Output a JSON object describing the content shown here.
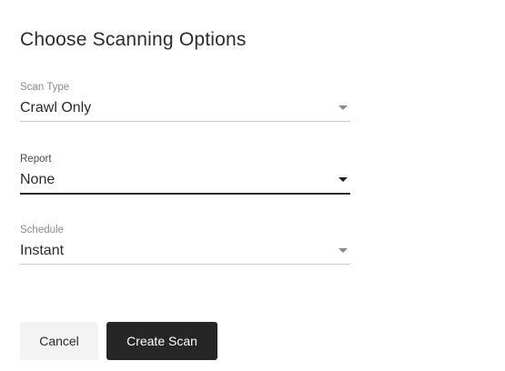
{
  "dialog": {
    "title": "Choose Scanning Options"
  },
  "fields": {
    "scan_type": {
      "label": "Scan Type",
      "value": "Crawl Only"
    },
    "report": {
      "label": "Report",
      "value": "None"
    },
    "schedule": {
      "label": "Schedule",
      "value": "Instant"
    }
  },
  "actions": {
    "cancel_label": "Cancel",
    "create_label": "Create Scan"
  },
  "colors": {
    "primary_button": "#262626",
    "secondary_button": "#f3f3f3",
    "text": "#2b2b2b",
    "muted_label": "#8a8a8a"
  }
}
